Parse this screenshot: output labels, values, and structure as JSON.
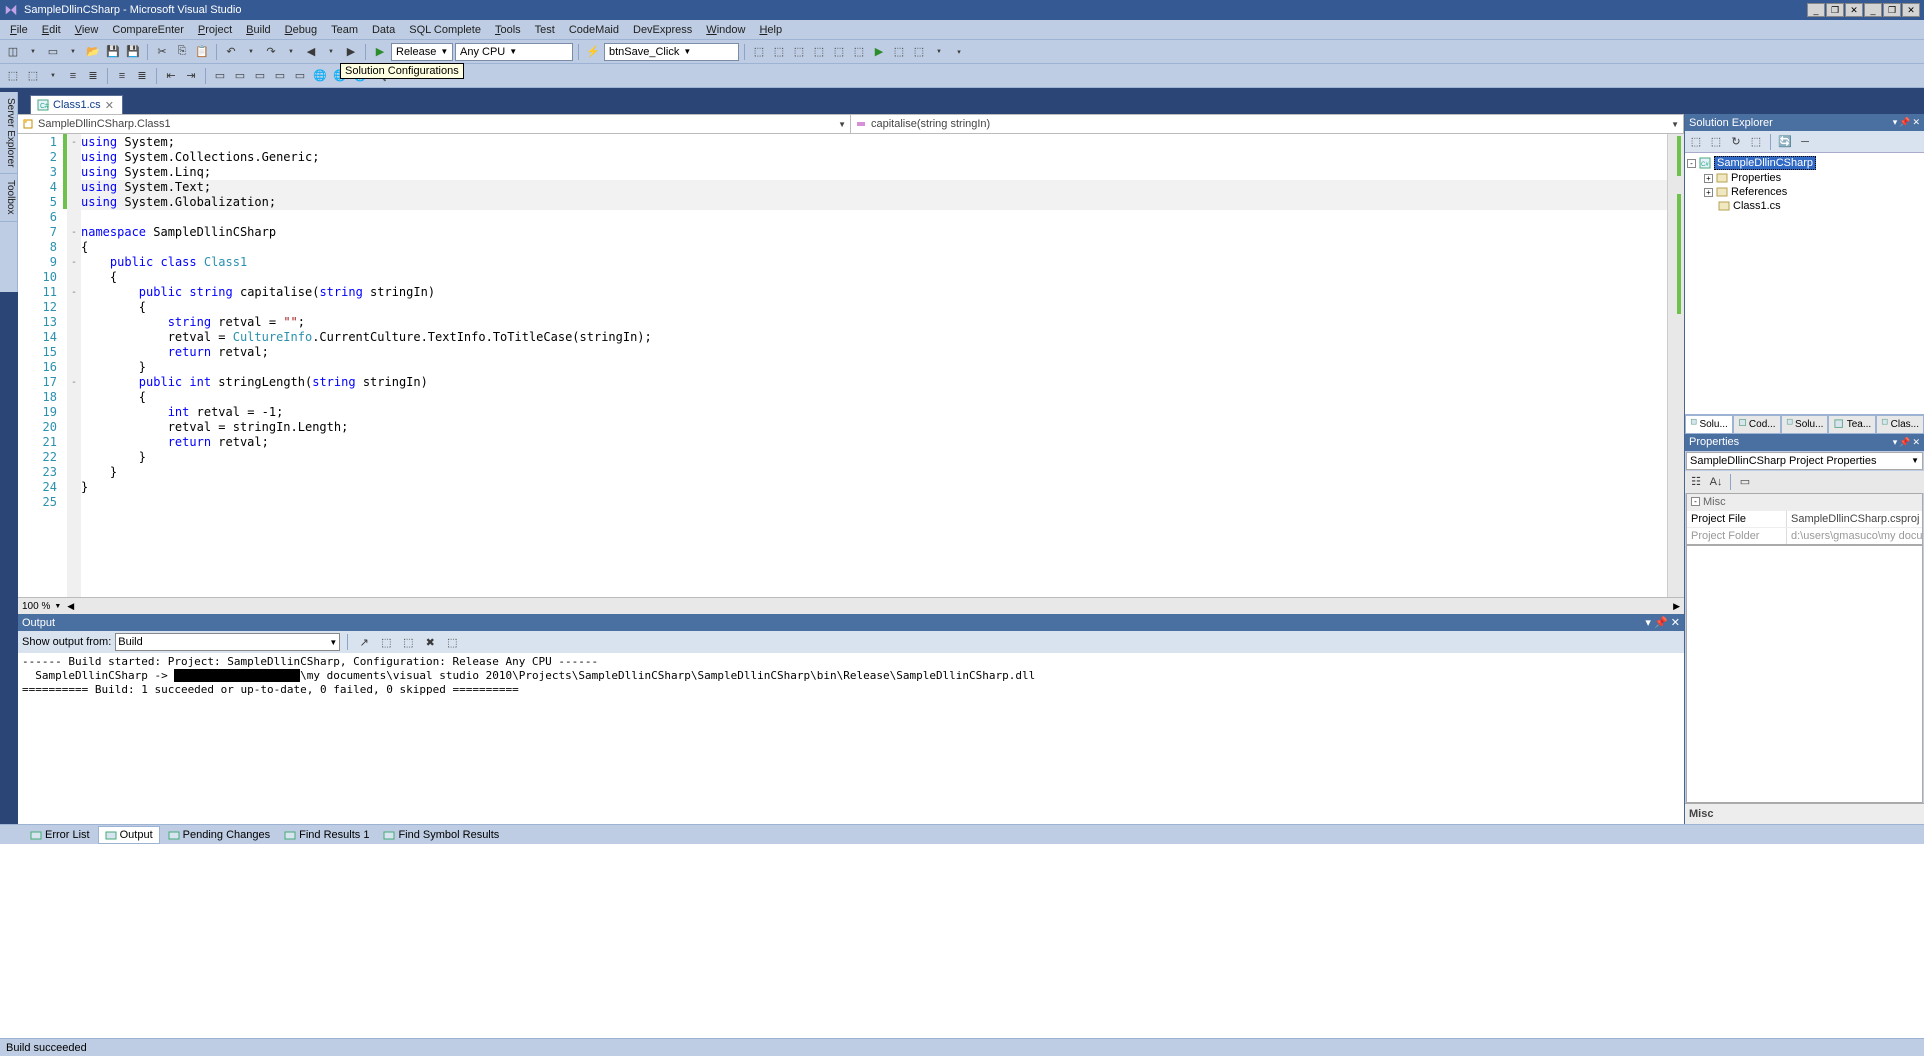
{
  "title": {
    "app_name": "SampleDllinCSharp - Microsoft Visual Studio"
  },
  "menu": [
    "File",
    "Edit",
    "View",
    "CompareEnter",
    "Project",
    "Build",
    "Debug",
    "Team",
    "Data",
    "SQL Complete",
    "Tools",
    "Test",
    "CodeMaid",
    "DevExpress",
    "Window",
    "Help"
  ],
  "menu_ul": [
    "F",
    "E",
    "V",
    "",
    "P",
    "B",
    "D",
    "",
    "",
    "",
    "T",
    "",
    "",
    "",
    "W",
    "H"
  ],
  "toolbar1": {
    "config": "Release",
    "platform": "Any CPU",
    "event": "btnSave_Click"
  },
  "tooltip": "Solution Configurations",
  "file_tab": {
    "name": "Class1.cs"
  },
  "side_tabs": [
    "Server Explorer",
    "Toolbox"
  ],
  "nav": {
    "class": "SampleDllinCSharp.Class1",
    "member": "capitalise(string stringIn)"
  },
  "code_lines": [
    {
      "n": 1,
      "fold": "-",
      "chg": true,
      "html": "<span class='kw'>using</span> System;"
    },
    {
      "n": 2,
      "fold": "",
      "chg": true,
      "html": "<span class='kw'>using</span> System.Collections.Generic;"
    },
    {
      "n": 3,
      "fold": "",
      "chg": true,
      "html": "<span class='kw'>using</span> System.Linq;"
    },
    {
      "n": 4,
      "fold": "",
      "chg": true,
      "hl": true,
      "html": "<span class='kw'>using</span> System.Text;"
    },
    {
      "n": 5,
      "fold": "",
      "chg": true,
      "hl": true,
      "html": "<span class='kw'>using</span> System.Globalization;"
    },
    {
      "n": 6,
      "fold": "",
      "chg": false,
      "html": ""
    },
    {
      "n": 7,
      "fold": "-",
      "chg": false,
      "html": "<span class='kw'>namespace</span> SampleDllinCSharp"
    },
    {
      "n": 8,
      "fold": "",
      "chg": false,
      "html": "{"
    },
    {
      "n": 9,
      "fold": "-",
      "chg": false,
      "html": "    <span class='kw'>public</span> <span class='kw'>class</span> <span class='typ'>Class1</span>"
    },
    {
      "n": 10,
      "fold": "",
      "chg": false,
      "html": "    {"
    },
    {
      "n": 11,
      "fold": "-",
      "chg": false,
      "html": "        <span class='kw'>public</span> <span class='kw'>string</span> capitalise(<span class='kw'>string</span> stringIn)"
    },
    {
      "n": 12,
      "fold": "",
      "chg": false,
      "html": "        {"
    },
    {
      "n": 13,
      "fold": "",
      "chg": false,
      "html": "            <span class='kw'>string</span> retval = <span class='str'>\"\"</span>;"
    },
    {
      "n": 14,
      "fold": "",
      "chg": false,
      "html": "            retval = <span class='typ'>CultureInfo</span>.CurrentCulture.TextInfo.ToTitleCase(stringIn);"
    },
    {
      "n": 15,
      "fold": "",
      "chg": false,
      "html": "            <span class='kw'>return</span> retval;"
    },
    {
      "n": 16,
      "fold": "",
      "chg": false,
      "html": "        }"
    },
    {
      "n": 17,
      "fold": "-",
      "chg": false,
      "html": "        <span class='kw'>public</span> <span class='kw'>int</span> stringLength(<span class='kw'>string</span> stringIn)"
    },
    {
      "n": 18,
      "fold": "",
      "chg": false,
      "html": "        {"
    },
    {
      "n": 19,
      "fold": "",
      "chg": false,
      "html": "            <span class='kw'>int</span> retval = -1;"
    },
    {
      "n": 20,
      "fold": "",
      "chg": false,
      "html": "            retval = stringIn.Length;"
    },
    {
      "n": 21,
      "fold": "",
      "chg": false,
      "html": "            <span class='kw'>return</span> retval;"
    },
    {
      "n": 22,
      "fold": "",
      "chg": false,
      "html": "        }"
    },
    {
      "n": 23,
      "fold": "",
      "chg": false,
      "html": "    }"
    },
    {
      "n": 24,
      "fold": "",
      "chg": false,
      "html": "}"
    },
    {
      "n": 25,
      "fold": "",
      "chg": false,
      "html": ""
    }
  ],
  "zoom": "100 %",
  "solution_explorer": {
    "title": "Solution Explorer",
    "root": "SampleDllinCSharp",
    "items": [
      {
        "indent": 14,
        "expand": "+",
        "icon": "props",
        "label": "Properties"
      },
      {
        "indent": 14,
        "expand": "+",
        "icon": "refs",
        "label": "References"
      },
      {
        "indent": 14,
        "expand": "",
        "icon": "cs",
        "label": "Class1.cs"
      }
    ],
    "tabs": [
      "Solu...",
      "Cod...",
      "Solu...",
      "Tea...",
      "Clas..."
    ]
  },
  "properties": {
    "title": "Properties",
    "selector": "SampleDllinCSharp Project Properties",
    "category": "Misc",
    "rows": [
      {
        "key": "Project File",
        "val": "SampleDllinCSharp.csproj"
      },
      {
        "key": "Project Folder",
        "val": "d:\\users\\gmasuco\\my documen"
      }
    ],
    "desc_title": "Misc"
  },
  "output": {
    "title": "Output",
    "show_label": "Show output from:",
    "source": "Build",
    "text_parts": [
      "------ Build started: Project: SampleDllinCSharp, Configuration: Release Any CPU ------",
      "  SampleDllinCSharp -> ",
      "\\my documents\\visual studio 2010\\Projects\\SampleDllinCSharp\\SampleDllinCSharp\\bin\\Release\\SampleDllinCSharp.dll",
      "========== Build: 1 succeeded or up-to-date, 0 failed, 0 skipped =========="
    ]
  },
  "bottom_tabs": [
    {
      "icon": "err",
      "label": "Error List"
    },
    {
      "icon": "out",
      "label": "Output",
      "active": true
    },
    {
      "icon": "pend",
      "label": "Pending Changes"
    },
    {
      "icon": "find",
      "label": "Find Results 1"
    },
    {
      "icon": "sym",
      "label": "Find Symbol Results"
    }
  ],
  "status": "Build succeeded"
}
